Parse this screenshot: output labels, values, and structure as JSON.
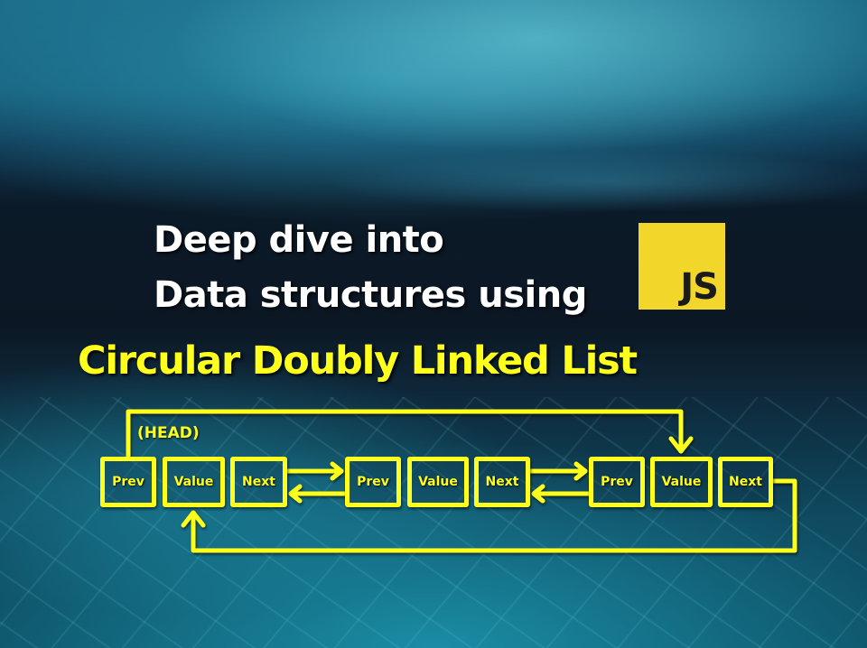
{
  "headline": {
    "line1": "Deep dive into",
    "line2": "Data structures using",
    "logo_text": "JS"
  },
  "subtitle": "Circular Doubly Linked List",
  "diagram": {
    "head_label": "(HEAD)",
    "nodes": [
      {
        "fields": [
          "Prev",
          "Value",
          "Next"
        ]
      },
      {
        "fields": [
          "Prev",
          "Value",
          "Next"
        ]
      },
      {
        "fields": [
          "Prev",
          "Value",
          "Next"
        ]
      }
    ],
    "links": [
      {
        "from": "node1.next",
        "to": "node2.prev",
        "type": "next"
      },
      {
        "from": "node2.prev",
        "to": "node1.next",
        "type": "prev"
      },
      {
        "from": "node2.next",
        "to": "node3.prev",
        "type": "next"
      },
      {
        "from": "node3.prev",
        "to": "node2.next",
        "type": "prev"
      },
      {
        "from": "node1.prev",
        "to": "node3.value",
        "type": "prev-wrap"
      },
      {
        "from": "node3.next",
        "to": "node1.value",
        "type": "next-wrap"
      }
    ]
  },
  "colors": {
    "accent_yellow": "#ffff1e",
    "js_logo_bg": "#f2d629",
    "js_logo_text": "#1b1b1b",
    "headline_text": "#ffffff"
  }
}
